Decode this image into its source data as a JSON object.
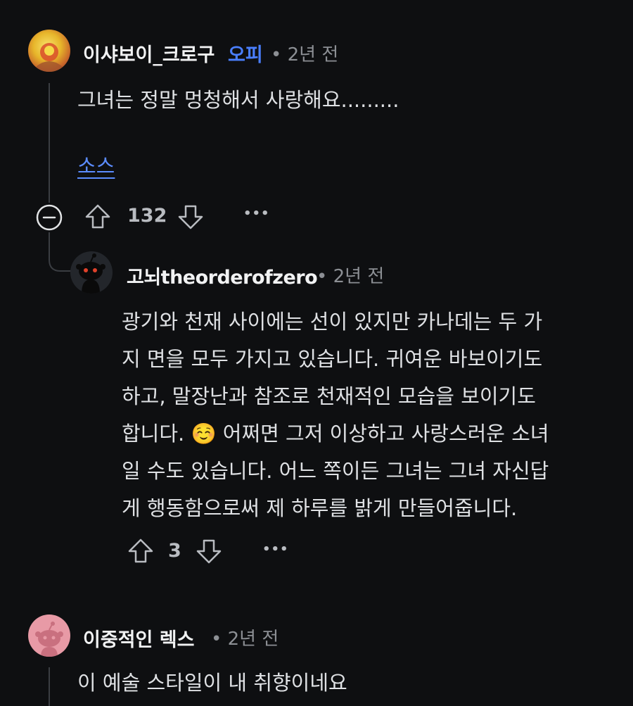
{
  "comments": [
    {
      "author": "이샤보이_크로구",
      "op_badge": "오피",
      "meta": "• 2년 전",
      "text": "그녀는 정말 멍청해서 사랑해요.........",
      "link_text": "소스",
      "votes": "132",
      "more": "•••"
    },
    {
      "author": "고뇌theorderofzero",
      "meta": "• 2년 전",
      "text_lines": [
        "광기와 천재 사이에는 선이 있지만 카나데는 두 가",
        "지 면을 모두 가지고 있습니다. 귀여운 바보이기도",
        "하고, 말장난과 참조로 천재적인 모습을 보이기도",
        "합니다. ☺️ 어쩌면 그저 이상하고 사랑스러운 소녀",
        "일 수도 있습니다. 어느 쪽이든 그녀는 그녀 자신답",
        "게 행동함으로써 제 하루를 밝게 만들어줍니다."
      ],
      "votes": "3",
      "more": "•••"
    },
    {
      "author": "이중적인 렉스",
      "meta": "• 2년 전",
      "text": "이 예술 스타일이 내 취향이네요"
    }
  ],
  "icons": {
    "collapse": "minus-circle-icon",
    "upvote": "arrow-up-icon",
    "downvote": "arrow-down-icon",
    "more": "more-dots-icon"
  },
  "colors": {
    "background": "#0e0f11",
    "op_badge": "#4a7fff",
    "link": "#5b8cff"
  }
}
